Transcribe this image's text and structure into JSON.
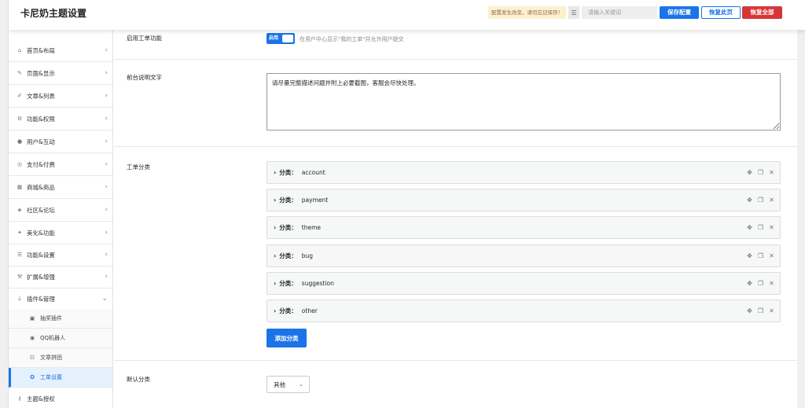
{
  "header": {
    "title": "卡尼奶主题设置",
    "notice": "配置发生改变，请勿忘记保存！",
    "search_placeholder": "请输入关键词",
    "save_label": "保存配置",
    "restore_page_label": "恢复此页",
    "restore_all_label": "恢复全部"
  },
  "sidebar": {
    "items": [
      {
        "label": "首页&布局",
        "icon": "home-icon"
      },
      {
        "label": "页面&显示",
        "icon": "pin-icon"
      },
      {
        "label": "文章&列表",
        "icon": "thumbtack-icon"
      },
      {
        "label": "功能&权限",
        "icon": "gears-icon"
      },
      {
        "label": "用户&互动",
        "icon": "user-icon"
      },
      {
        "label": "支付&付费",
        "icon": "coin-icon"
      },
      {
        "label": "商城&商品",
        "icon": "store-icon"
      },
      {
        "label": "社区&论坛",
        "icon": "forum-icon"
      },
      {
        "label": "美化&功能",
        "icon": "magic-wand-icon"
      },
      {
        "label": "功能&设置",
        "icon": "sliders-icon"
      },
      {
        "label": "扩展&增强",
        "icon": "wrench-icon"
      },
      {
        "label": "插件&管理",
        "icon": "plug-icon"
      }
    ],
    "subitems": [
      {
        "label": "抽奖插件",
        "icon": "gift-icon"
      },
      {
        "label": "QQ机器人",
        "icon": "robot-icon"
      },
      {
        "label": "文章拼团",
        "icon": "group-icon"
      },
      {
        "label": "工单设置",
        "icon": "support-icon"
      }
    ],
    "last_item": {
      "label": "主题&授权",
      "icon": "key-icon"
    }
  },
  "content": {
    "enable": {
      "label": "启用工单功能",
      "toggle_text": "启用",
      "hint": "在用户中心显示\"我的工单\"并允许用户提交"
    },
    "description": {
      "label": "前台说明文字",
      "value": "请尽量完整描述问题并附上必要截图，客服会尽快处理。"
    },
    "categories": {
      "label": "工单分类",
      "key_label": "分类：",
      "items": [
        "account",
        "payment",
        "theme",
        "bug",
        "suggestion",
        "other"
      ],
      "add_label": "添加分类"
    },
    "default_category": {
      "label": "默认分类",
      "value": "其他"
    }
  }
}
